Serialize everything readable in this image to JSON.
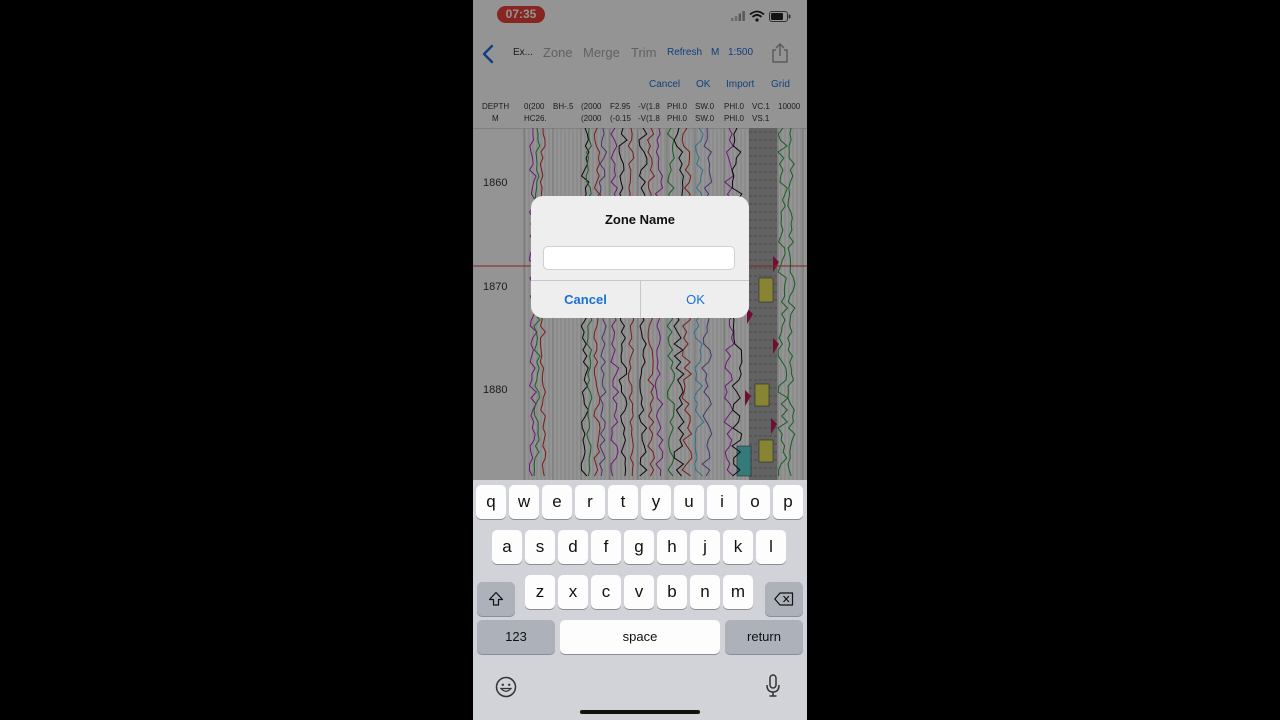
{
  "status_bar": {
    "time": "07:35"
  },
  "navbar": {
    "title": "Ex...",
    "tabs": [
      "Zone",
      "Merge",
      "Trim"
    ],
    "refresh": "Refresh",
    "unit": "M",
    "scale": "1:500"
  },
  "edit_bar": {
    "cancel": "Cancel",
    "ok": "OK",
    "import": "Import",
    "grid": "Grid"
  },
  "track_headers": {
    "depth": "DEPTH",
    "depth_unit": "M",
    "row1": [
      "0(200",
      "BH-.5",
      "(2000",
      "F2.95",
      "-V(1.8",
      "PHI.0",
      "SW.0",
      "PHI.0",
      "VC.1",
      "10000"
    ],
    "row2": [
      "HC26.",
      "",
      "(2000",
      "(-0.15",
      "-V(1.8",
      "PHI.0",
      "SW.0",
      "PHI.0",
      "VS.1",
      ""
    ]
  },
  "depth_labels": [
    "1860",
    "1870",
    "1880"
  ],
  "dialog": {
    "title": "Zone Name",
    "input_value": "",
    "cancel": "Cancel",
    "ok": "OK"
  },
  "keyboard": {
    "row1": [
      "q",
      "w",
      "e",
      "r",
      "t",
      "y",
      "u",
      "i",
      "o",
      "p"
    ],
    "row2": [
      "a",
      "s",
      "d",
      "f",
      "g",
      "h",
      "j",
      "k",
      "l"
    ],
    "row3": [
      "z",
      "x",
      "c",
      "v",
      "b",
      "n",
      "m"
    ],
    "numbers": "123",
    "space": "space",
    "return": "return"
  }
}
